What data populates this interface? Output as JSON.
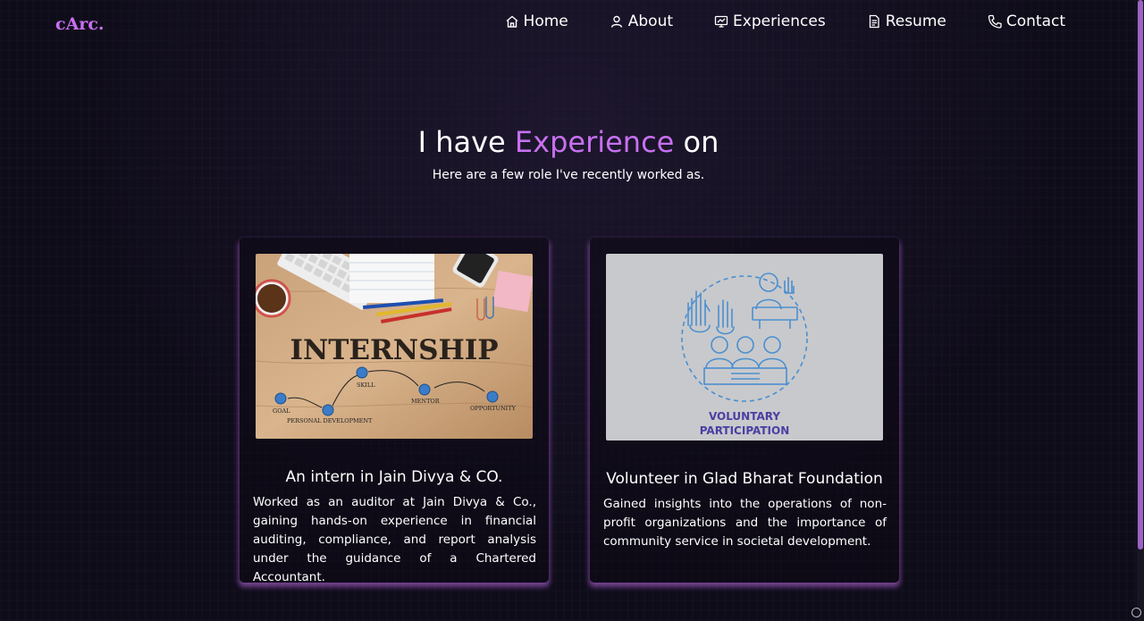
{
  "logo": "cArc.",
  "nav": {
    "home": "Home",
    "about": "About",
    "experiences": "Experiences",
    "resume": "Resume",
    "contact": "Contact"
  },
  "section": {
    "heading_prefix": "I have",
    "heading_highlight": "Experience",
    "heading_suffix": "on",
    "subheading": "Here are a few role I've recently worked as."
  },
  "cards": [
    {
      "title": "An intern in Jain Divya & CO.",
      "description": "Worked as an auditor at Jain Divya & Co., gaining hands-on experience in financial auditing, compliance, and report analysis under the guidance of a Chartered Accountant.",
      "image": {
        "headline": "INTERNSHIP",
        "labels": [
          "GOAL",
          "PERSONAL DEVELOPMENT",
          "SKILL",
          "MENTOR",
          "OPPORTUNITY"
        ]
      }
    },
    {
      "title": "Volunteer in Glad Bharat Foundation",
      "description": "Gained insights into the operations of non-profit organizations and the importance of community service in societal development.",
      "image": {
        "line1": "VOLUNTARY",
        "line2": "PARTICIPATION"
      }
    }
  ],
  "colors": {
    "accent": "#c770f0",
    "background": "#0f0c1a"
  }
}
